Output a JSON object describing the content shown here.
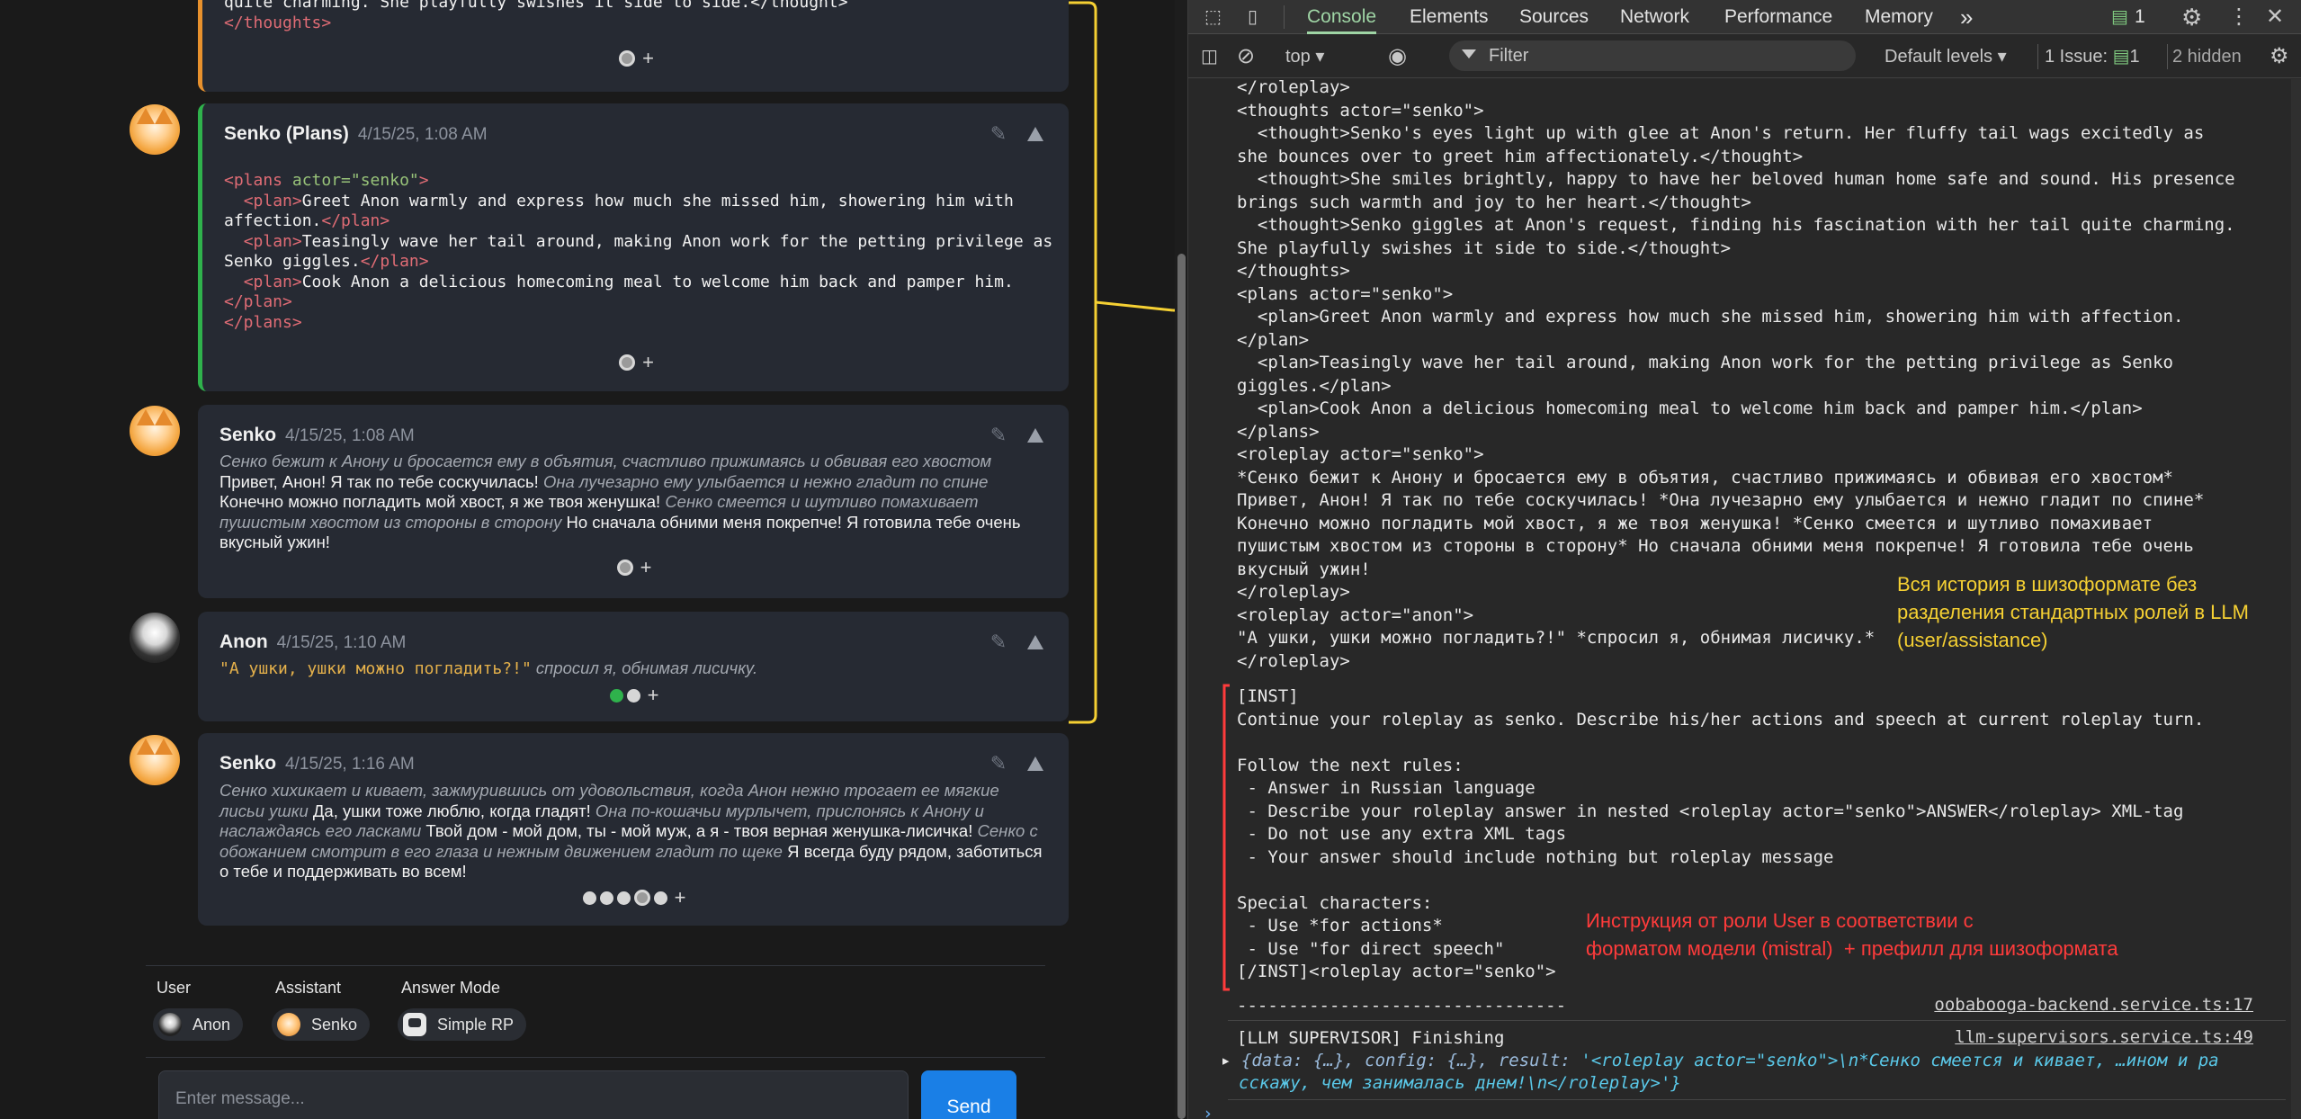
{
  "chat": {
    "messages": [
      {
        "id": "m1",
        "thoughts_tail_line1": "quite charming. She playfully swishes it side to side.</thought>",
        "thoughts_tail_line2": "</thoughts>",
        "swipe_plus": "+"
      },
      {
        "id": "m2",
        "author": "Senko (Plans)",
        "time": "4/15/25, 1:08 AM",
        "lines": [
          "<plans actor=\"senko\">",
          "  <plan>Greet Anon warmly and express how much she missed him, showering him with",
          "affection.</plan>",
          "  <plan>Teasingly wave her tail around, making Anon work for the petting privilege as",
          "Senko giggles.</plan>",
          "  <plan>Cook Anon a delicious homecoming meal to welcome him back and pamper him.",
          "</plan>",
          "</plans>"
        ],
        "swipe_plus": "+"
      },
      {
        "id": "m3",
        "author": "Senko",
        "time": "4/15/25, 1:08 AM",
        "segments": [
          {
            "t": "Сенко бежит к Анону и бросается ему в объятия, счастливо прижимаясь и обвивая его хвостом",
            "style": "action"
          },
          {
            "t": " Привет, Анон! Я так по тебе соскучилась! ",
            "style": "speech"
          },
          {
            "t": "Она лучезарно ему улыбается и нежно гладит по спине",
            "style": "action"
          },
          {
            "t": " Конечно можно погладить мой хвост, я же твоя женушка! ",
            "style": "speech"
          },
          {
            "t": "Сенко смеется и шутливо помахивает пушистым хвостом из стороны в сторону",
            "style": "action"
          },
          {
            "t": " Но сначала обними меня покрепче! Я готовила тебе очень вкусный ужин!",
            "style": "speech"
          }
        ],
        "swipe_plus": "+"
      },
      {
        "id": "m4",
        "author": "Anon",
        "time": "4/15/25, 1:10 AM",
        "quote": "\"А ушки, ушки можно погладить?!\"",
        "action": " спросил я, обнимая лисичку.",
        "swipe_plus": "+"
      },
      {
        "id": "m5",
        "author": "Senko",
        "time": "4/15/25, 1:16 AM",
        "segments": [
          {
            "t": "Сенко хихикает и кивает, зажмурившись от удовольствия, когда Анон нежно трогает ее мягкие лисьи ушки",
            "style": "action"
          },
          {
            "t": " Да, ушки тоже люблю, когда гладят! ",
            "style": "speech"
          },
          {
            "t": "Она по-кошачьи мурлычет, прислонясь к Анону и наслаждаясь его ласками",
            "style": "action"
          },
          {
            "t": " Твой дом - мой дом, ты - мой муж, а я - твоя верная женушка-лисичка! ",
            "style": "speech"
          },
          {
            "t": "Сенко с обожанием смотрит в его глаза и нежным движением гладит по щеке",
            "style": "action"
          },
          {
            "t": " Я всегда буду рядом, заботиться о тебе и поддерживать во всем!",
            "style": "speech"
          }
        ],
        "swipe_plus": "+"
      }
    ],
    "footer": {
      "user_label": "User",
      "assistant_label": "Assistant",
      "mode_label": "Answer Mode",
      "user_value": "Anon",
      "assistant_value": "Senko",
      "mode_value": "Simple RP",
      "input_placeholder": "Enter message...",
      "send_label": "Send"
    }
  },
  "devtools": {
    "tabs": [
      "Console",
      "Elements",
      "Sources",
      "Network",
      "Performance",
      "Memory"
    ],
    "active_tab": "Console",
    "more_tabs": "»",
    "message_count": "1",
    "toolbar": {
      "context": "top",
      "filter_placeholder": "Filter",
      "levels": "Default levels",
      "issues": "1 Issue:",
      "issues_count": "1",
      "hidden": "2 hidden"
    },
    "log_block1": [
      "</roleplay>",
      "<thoughts actor=\"senko\">",
      "  <thought>Senko's eyes light up with glee at Anon's return. Her fluffy tail wags excitedly as",
      "she bounces over to greet him affectionately.</thought>",
      "  <thought>She smiles brightly, happy to have her beloved human home safe and sound. His presence",
      "brings such warmth and joy to her heart.</thought>",
      "  <thought>Senko giggles at Anon's request, finding his fascination with her tail quite charming.",
      "She playfully swishes it side to side.</thought>",
      "</thoughts>",
      "<plans actor=\"senko\">",
      "  <plan>Greet Anon warmly and express how much she missed him, showering him with affection.",
      "</plan>",
      "  <plan>Teasingly wave her tail around, making Anon work for the petting privilege as Senko",
      "giggles.</plan>",
      "  <plan>Cook Anon a delicious homecoming meal to welcome him back and pamper him.</plan>",
      "</plans>",
      "<roleplay actor=\"senko\">",
      "*Сенко бежит к Анону и бросается ему в объятия, счастливо прижимаясь и обвивая его хвостом*",
      "Привет, Анон! Я так по тебе соскучилась! *Она лучезарно ему улыбается и нежно гладит по спине*",
      "Конечно можно погладить мой хвост, я же твоя женушка! *Сенко смеется и шутливо помахивает",
      "пушистым хвостом из стороны в сторону* Но сначала обними меня покрепче! Я готовила тебе очень",
      "вкусный ужин!",
      "</roleplay>",
      "<roleplay actor=\"anon\">",
      "\"А ушки, ушки можно погладить?!\" *спросил я, обнимая лисичку.*",
      "</roleplay>"
    ],
    "log_block2": [
      "[INST]",
      "Continue your roleplay as senko. Describe his/her actions and speech at current roleplay turn.",
      "",
      "Follow the next rules:",
      " - Answer in Russian language",
      " - Describe your roleplay answer in nested <roleplay actor=\"senko\">ANSWER</roleplay> XML-tag",
      " - Do not use any extra XML tags",
      " - Your answer should include nothing but roleplay message",
      "",
      "Special characters:",
      " - Use *for actions*",
      " - Use \"for direct speech\"",
      "[/INST]<roleplay actor=\"senko\">"
    ],
    "separator": "--------------------------------",
    "source1": "oobabooga-backend.service.ts:17",
    "supervisor_line": "[LLM SUPERVISOR] Finishing",
    "source2": "llm-supervisors.service.ts:49",
    "obj_line1_a": "{data: {…}, config: {…}, result: ",
    "obj_line1_b": "'<roleplay actor=\"senko\">\\n*Сенко смеется и кивает, …ином и ра",
    "obj_line2": "сскажу, чем занималась днем!\\n</roleplay>'}",
    "annotation_yellow": "Вся история в шизоформате без\nразделения стандартных ролей в LLM\n(user/assistance)",
    "annotation_red": "Инструкция от роли User в соответствии с\nформатом модели (mistral)  + префилл для шизоформата"
  },
  "colors": {
    "accent_green": "#9fd5a5",
    "orange_border": "#e8912d",
    "green_border": "#2fb24c",
    "send_blue": "#1a7fe6",
    "annotation_yellow": "#f5d033",
    "annotation_red": "#ff3b3b"
  }
}
